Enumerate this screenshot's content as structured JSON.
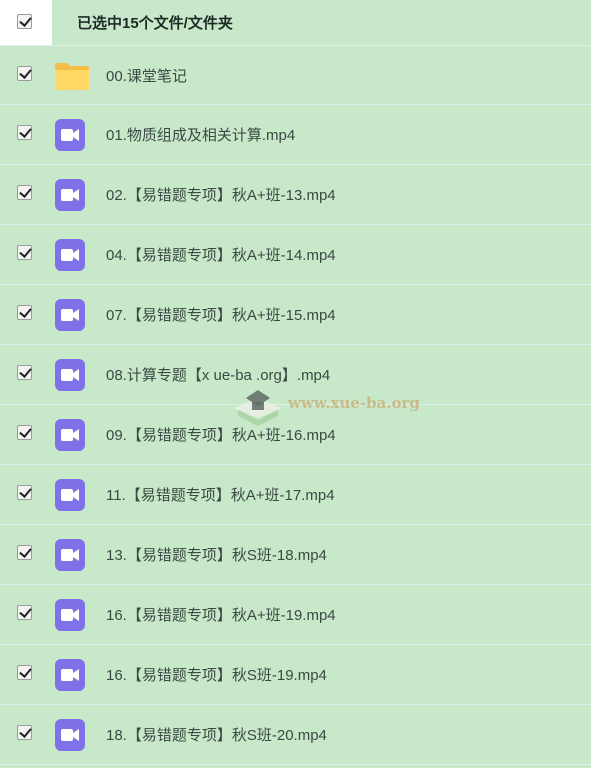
{
  "header": {
    "label": "已选中15个文件/文件夹"
  },
  "files": [
    {
      "name": "00.课堂笔记",
      "type": "folder"
    },
    {
      "name": "01.物质组成及相关计算.mp4",
      "type": "video"
    },
    {
      "name": "02.【易错题专项】秋A+班-13.mp4",
      "type": "video"
    },
    {
      "name": "04.【易错题专项】秋A+班-14.mp4",
      "type": "video"
    },
    {
      "name": "07.【易错题专项】秋A+班-15.mp4",
      "type": "video"
    },
    {
      "name": "08.计算专题【x ue-ba .org】.mp4",
      "type": "video"
    },
    {
      "name": "09.【易错题专项】秋A+班-16.mp4",
      "type": "video"
    },
    {
      "name": "11.【易错题专项】秋A+班-17.mp4",
      "type": "video"
    },
    {
      "name": "13.【易错题专项】秋S班-18.mp4",
      "type": "video"
    },
    {
      "name": "16.【易错题专项】秋A+班-19.mp4",
      "type": "video"
    },
    {
      "name": "16.【易错题专项】秋S班-19.mp4",
      "type": "video"
    },
    {
      "name": "18.【易错题专项】秋S班-20.mp4",
      "type": "video"
    }
  ],
  "watermark": {
    "text": "www.xue-ba.org"
  },
  "colors": {
    "background": "#c7e8c9",
    "video_icon": "#7f72e8",
    "folder_icon": "#f9cf5e",
    "row_divider": "#dcefea"
  }
}
